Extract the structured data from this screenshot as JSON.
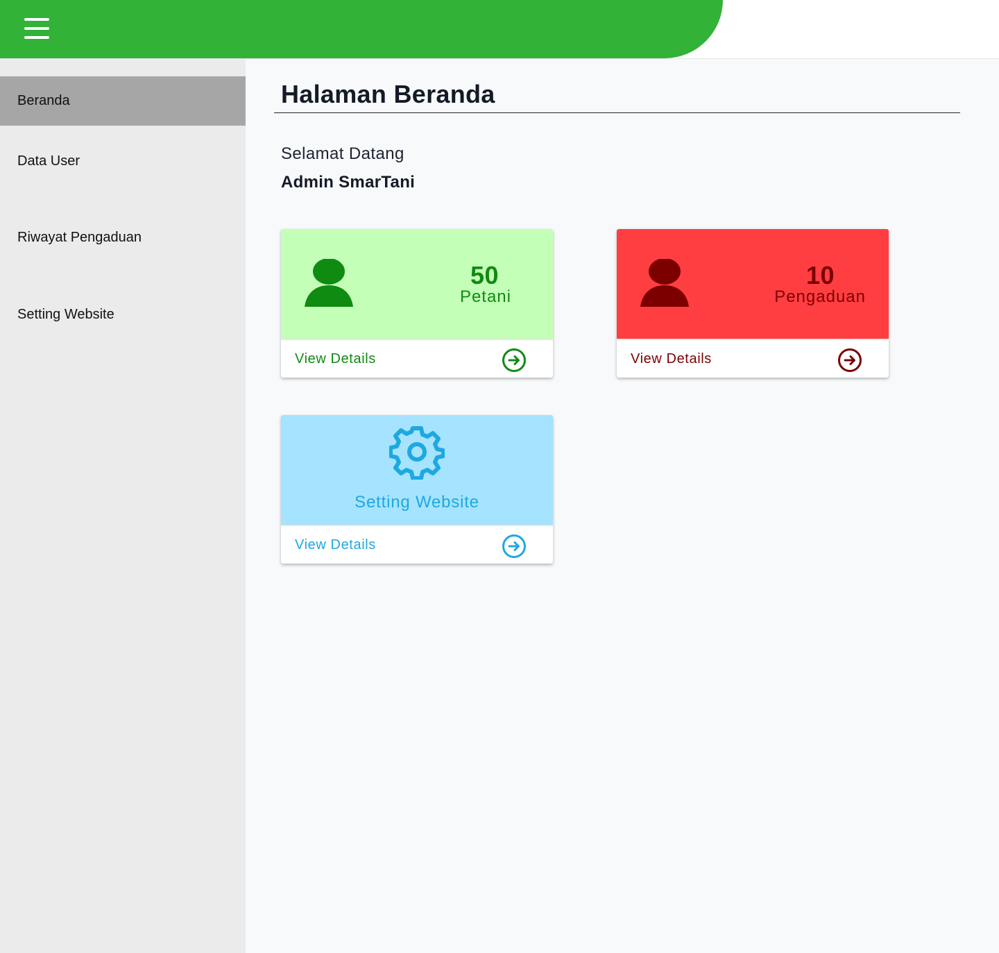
{
  "colors": {
    "header_green": "#32b237",
    "petani_bg": "#c4ffb7",
    "petani_fg": "#0f8b12",
    "pengaduan_bg": "#ff3e42",
    "pengaduan_fg": "#7c0000",
    "setting_bg": "#a5e3ff",
    "setting_fg": "#1ea8e0"
  },
  "header": {
    "menu_icon": "hamburger-menu-icon"
  },
  "sidebar": {
    "items": [
      {
        "label": "Beranda",
        "active": true
      },
      {
        "label": "Data User",
        "active": false
      },
      {
        "label": "Riwayat Pengaduan",
        "active": false
      },
      {
        "label": "Setting Website",
        "active": false
      }
    ]
  },
  "main": {
    "title": "Halaman Beranda",
    "welcome": "Selamat Datang",
    "user": "Admin SmarTani"
  },
  "cards": {
    "petani": {
      "value": "50",
      "label": "Petani",
      "icon": "person-icon",
      "link": "View Details",
      "link_icon": "arrow-circle-right-icon"
    },
    "pengaduan": {
      "value": "10",
      "label": "Pengaduan",
      "icon": "person-icon",
      "link": "View Details",
      "link_icon": "arrow-circle-right-icon"
    },
    "setting": {
      "label": "Setting Website",
      "icon": "gear-icon",
      "link": "View Details",
      "link_icon": "arrow-circle-right-icon"
    }
  }
}
